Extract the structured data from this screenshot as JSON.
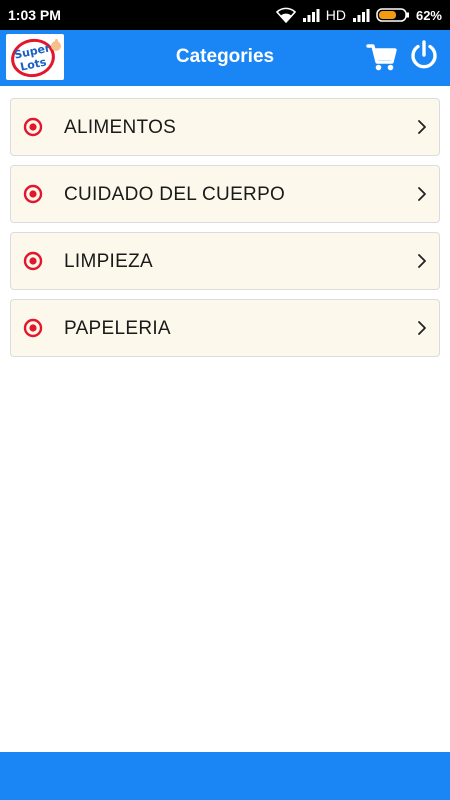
{
  "status_bar": {
    "time": "1:03 PM",
    "network": "HD",
    "battery": "62%",
    "icons": [
      "wifi-icon",
      "signal-icon",
      "battery-icon"
    ]
  },
  "app_bar": {
    "title": "Categories",
    "logo_text": [
      "Super",
      "Lots"
    ],
    "icons": [
      "cart-icon",
      "power-icon"
    ]
  },
  "categories": [
    {
      "label": "ALIMENTOS",
      "icon": "target-icon"
    },
    {
      "label": "CUIDADO DEL CUERPO",
      "icon": "target-icon"
    },
    {
      "label": "LIMPIEZA",
      "icon": "target-icon"
    },
    {
      "label": "PAPELERIA",
      "icon": "target-icon"
    }
  ],
  "colors": {
    "primary": "#1a86f5",
    "item_background": "#fdf8ec",
    "accent_red": "#e3172b",
    "battery_fill": "#f39c12"
  }
}
